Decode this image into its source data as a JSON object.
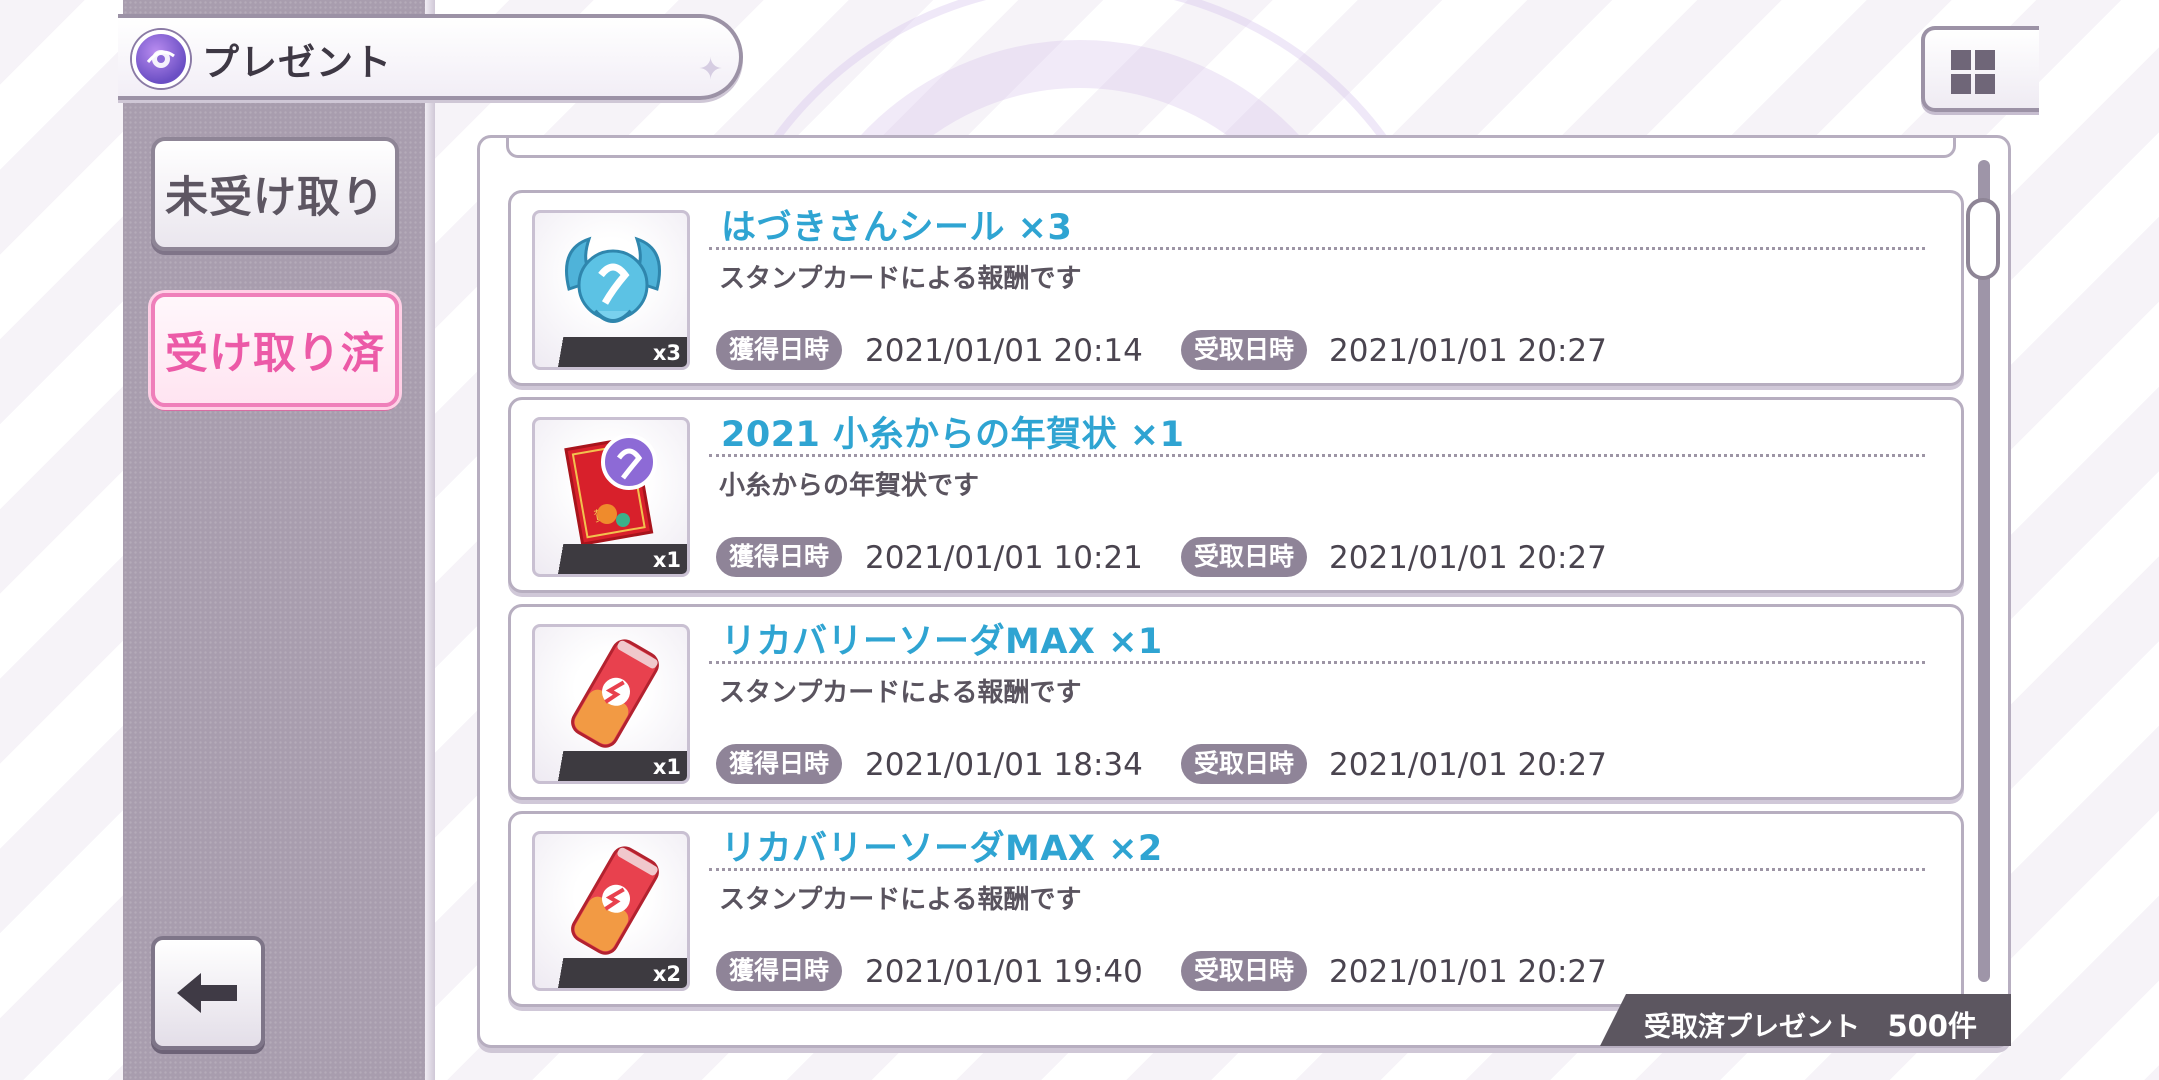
{
  "header": {
    "title": "プレゼント"
  },
  "sidebar": {
    "tabs": [
      {
        "label": "未受け取り",
        "selected": false
      },
      {
        "label": "受け取り済",
        "selected": true
      }
    ],
    "back_icon": "left-arrow-icon"
  },
  "toolbar": {
    "grid_icon": "grid-icon"
  },
  "items": [
    {
      "title": "はづきさんシール ×3",
      "description": "スタンプカードによる報酬です",
      "quantity": "x3",
      "icon": "swan-sticker-icon",
      "acquired_label": "獲得日時",
      "acquired": "2021/01/01 20:14",
      "received_label": "受取日時",
      "received": "2021/01/01 20:27"
    },
    {
      "title": "2021 小糸からの年賀状 ×1",
      "description": "小糸からの年賀状です",
      "quantity": "x1",
      "icon": "new-year-card-icon",
      "acquired_label": "獲得日時",
      "acquired": "2021/01/01 10:21",
      "received_label": "受取日時",
      "received": "2021/01/01 20:27"
    },
    {
      "title": "リカバリーソーダMAX ×1",
      "description": "スタンプカードによる報酬です",
      "quantity": "x1",
      "icon": "soda-can-icon",
      "acquired_label": "獲得日時",
      "acquired": "2021/01/01 18:34",
      "received_label": "受取日時",
      "received": "2021/01/01 20:27"
    },
    {
      "title": "リカバリーソーダMAX ×2",
      "description": "スタンプカードによる報酬です",
      "quantity": "x2",
      "icon": "soda-can-icon",
      "acquired_label": "獲得日時",
      "acquired": "2021/01/01 19:40",
      "received_label": "受取日時",
      "received": "2021/01/01 20:27"
    }
  ],
  "footer": {
    "label": "受取済プレゼント",
    "count": "500件"
  },
  "colors": {
    "sidebar": "#a89dae",
    "selected_tab": "#ec5aa7",
    "item_title": "#2fa4d2",
    "date_tag": "#8f8498",
    "footer_bg": "#5c5660"
  }
}
